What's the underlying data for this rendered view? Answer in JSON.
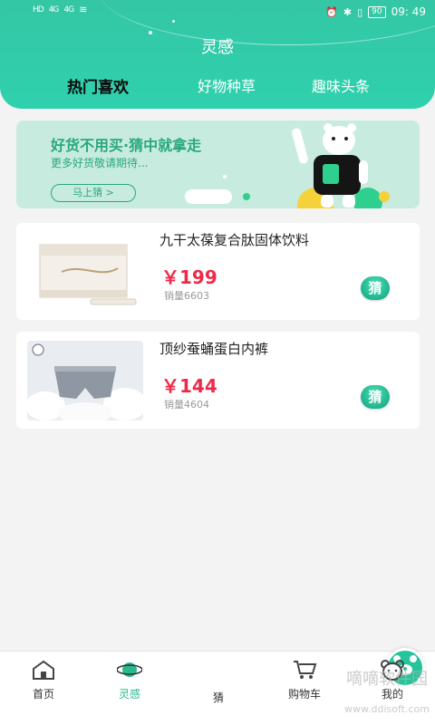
{
  "status_bar": {
    "left": [
      "HD",
      "4G",
      "4G"
    ],
    "battery": "90",
    "time": "09: 49"
  },
  "header": {
    "title": "灵感",
    "tabs": [
      {
        "label": "热门喜欢",
        "active": true
      },
      {
        "label": "好物种草",
        "active": false
      },
      {
        "label": "趣味头条",
        "active": false
      }
    ]
  },
  "banner": {
    "headline": "好货不用买·猜中就拿走",
    "subtext": "更多好货敬请期待...",
    "button_label": "马上猜 >"
  },
  "products": [
    {
      "name": "九干太葆复合肽固体饮料",
      "price": "￥199",
      "sales": "销量6603",
      "guess_label": "猜"
    },
    {
      "name": "顶纱蚕蛹蛋白内裤",
      "price": "￥144",
      "sales": "销量4604",
      "guess_label": "猜"
    }
  ],
  "tabbar": {
    "items": [
      {
        "label": "首页",
        "icon": "home-icon"
      },
      {
        "label": "灵感",
        "icon": "planet-icon",
        "active": true
      },
      {
        "label": "猜",
        "icon": "bear-face-icon"
      },
      {
        "label": "购物车",
        "icon": "cart-icon"
      },
      {
        "label": "我的",
        "icon": "bear-head-icon"
      }
    ]
  },
  "watermark": {
    "text": "嘀嘀软件园",
    "url": "www.ddisoft.com"
  },
  "colors": {
    "accent": "#2fc7a3",
    "price": "#ee2a4a",
    "banner_bg": "#c7ecdf"
  }
}
